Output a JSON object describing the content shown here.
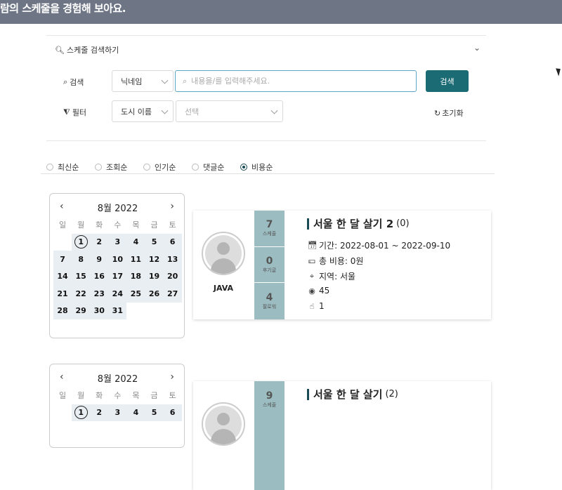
{
  "banner": {
    "text": "람의 스케줄을 경험해 보아요."
  },
  "search": {
    "accordion_label": "스케줄 검색하기",
    "search_label": "검색",
    "filter_label": "필터",
    "type_select": "닉네임",
    "placeholder": "내용을/를 입력해주세요.",
    "search_button": "검색",
    "city_select": "도시 이름",
    "option_select": "선택",
    "reset_label": "초기화"
  },
  "sort": {
    "options": [
      "최신순",
      "조회순",
      "인기순",
      "댓글순",
      "비용순"
    ],
    "selected": "비용순"
  },
  "calendar": {
    "month_label": "8월 2022",
    "weekdays": [
      "일",
      "월",
      "화",
      "수",
      "목",
      "금",
      "토"
    ]
  },
  "cards": [
    {
      "author": "JAVA",
      "stats": [
        {
          "num": "7",
          "label": "스케줄"
        },
        {
          "num": "0",
          "label": "후기글"
        },
        {
          "num": "4",
          "label": "팔로워"
        }
      ],
      "title": "서울 한 달 살기 2",
      "count": "(0)",
      "period": "기간: 2022-08-01 ~ 2022-09-10",
      "cost": "총 비용: 0원",
      "region": "지역: 서울",
      "views": "45",
      "likes": "1"
    },
    {
      "author": "",
      "stats": [
        {
          "num": "9",
          "label": "스케줄"
        }
      ],
      "title": "서울 한 달 살기",
      "count": "(2)"
    }
  ],
  "colors": {
    "topbar": "#6e7686",
    "accent": "#1a6b73",
    "stats_bg": "#9bbcc0"
  }
}
